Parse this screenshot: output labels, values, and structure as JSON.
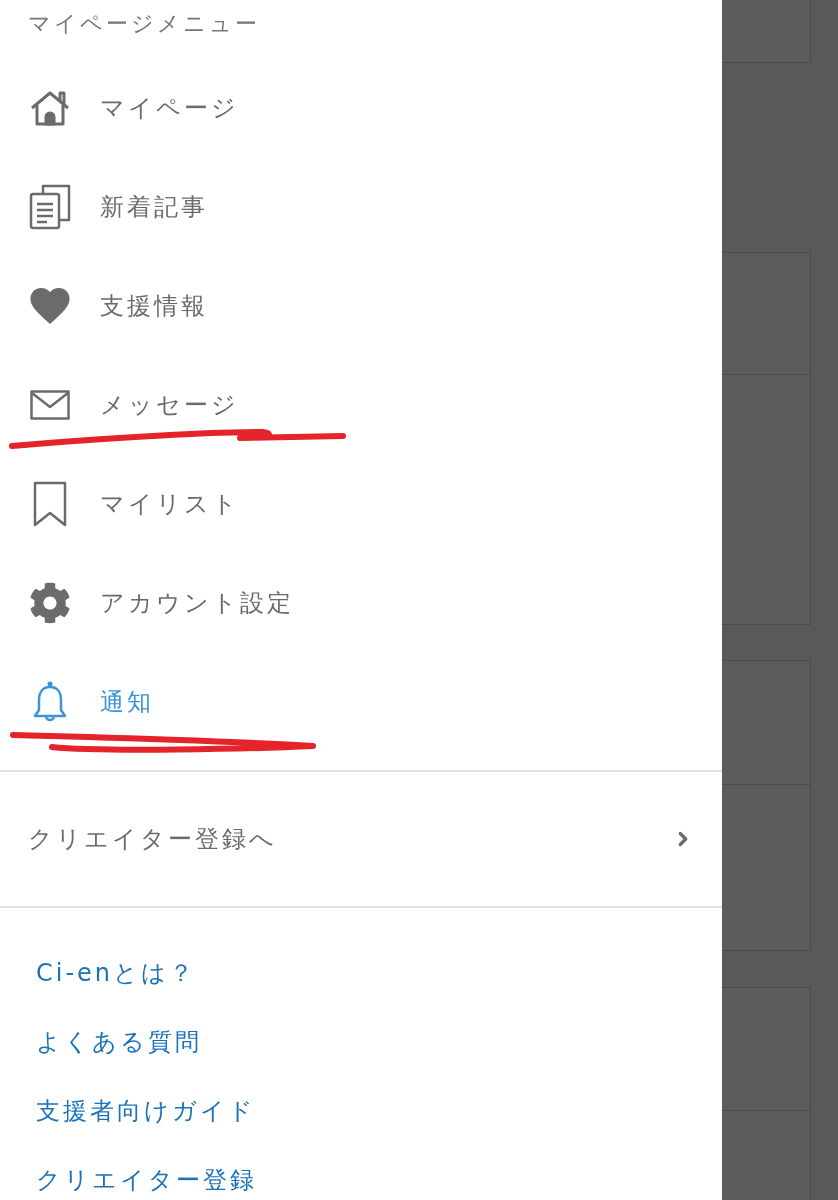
{
  "drawer": {
    "title": "マイページメニュー",
    "menu_items": [
      {
        "label": "マイページ",
        "selected": false,
        "underlined": false
      },
      {
        "label": "新着記事",
        "selected": false,
        "underlined": false
      },
      {
        "label": "支援情報",
        "selected": false,
        "underlined": false
      },
      {
        "label": "メッセージ",
        "selected": false,
        "underlined": true
      },
      {
        "label": "マイリスト",
        "selected": false,
        "underlined": false
      },
      {
        "label": "アカウント設定",
        "selected": false,
        "underlined": false
      },
      {
        "label": "通知",
        "selected": true,
        "underlined": true
      }
    ],
    "creator_row": {
      "label": "クリエイター登録へ"
    },
    "links": [
      "Ci-enとは？",
      "よくある質問",
      "支援者向けガイド",
      "クリエイター登録"
    ]
  }
}
